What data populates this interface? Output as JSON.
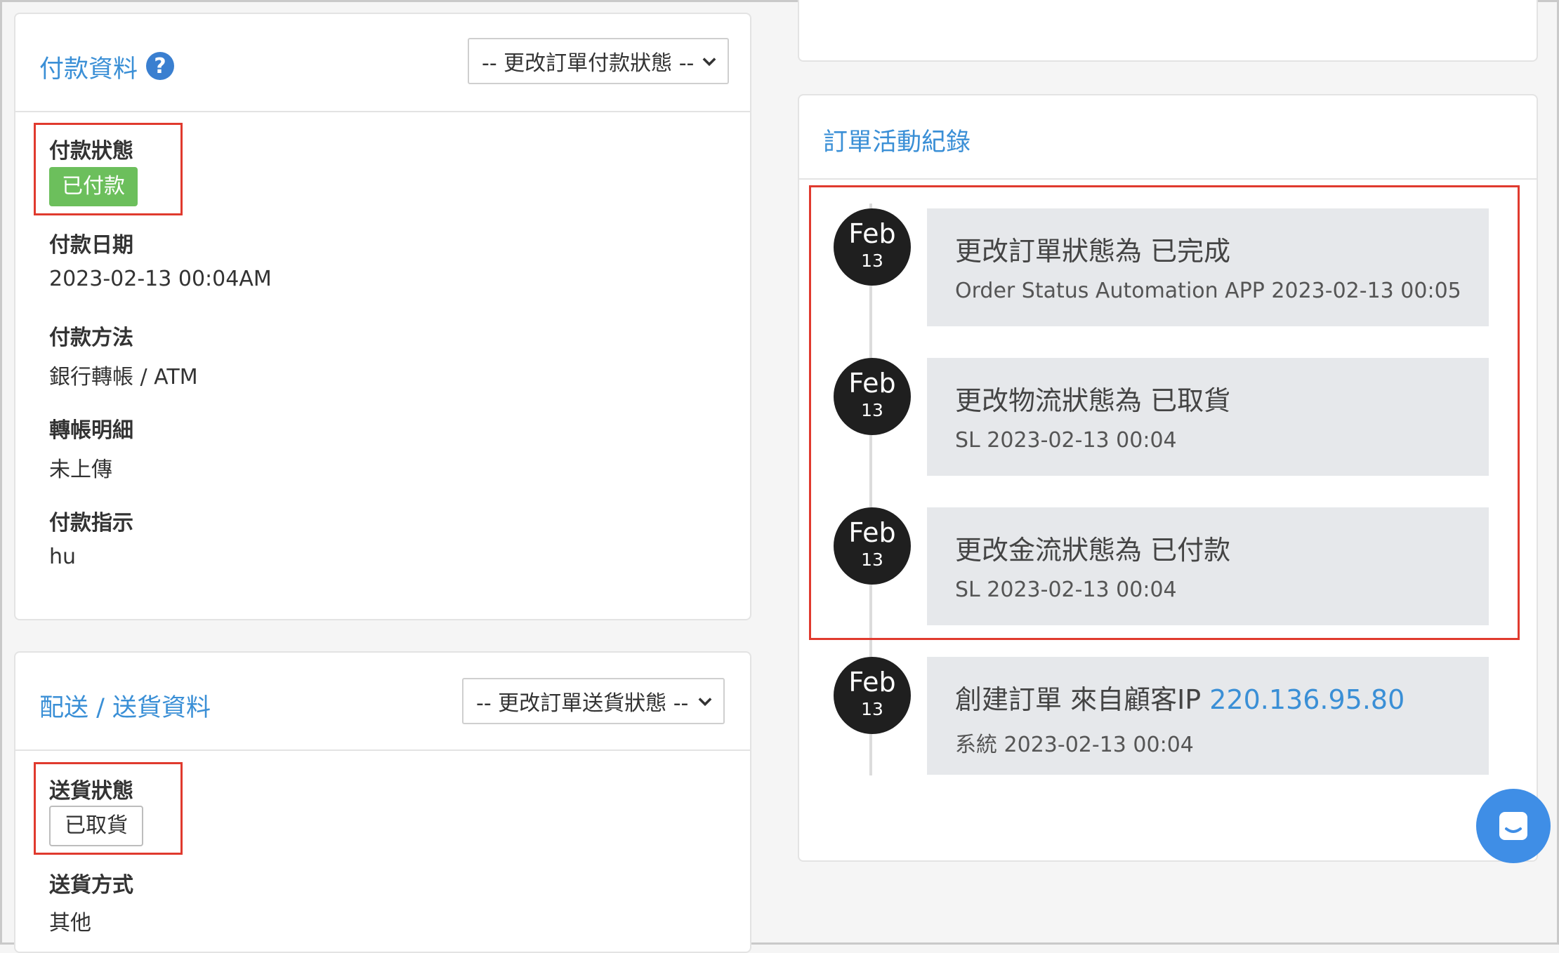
{
  "payment": {
    "title": "付款資料",
    "status_select": "-- 更改訂單付款狀態 --",
    "status_label": "付款狀態",
    "status_value": "已付款",
    "date_label": "付款日期",
    "date_value": "2023-02-13 00:04AM",
    "method_label": "付款方法",
    "method_value": "銀行轉帳 / ATM",
    "transfer_label": "轉帳明細",
    "transfer_value": "未上傳",
    "instruction_label": "付款指示",
    "instruction_value": "hu"
  },
  "delivery": {
    "title": "配送 / 送貨資料",
    "status_select": "-- 更改訂單送貨狀態 --",
    "status_label": "送貨狀態",
    "status_value": "已取貨",
    "method_label": "送貨方式",
    "method_value": "其他"
  },
  "activity": {
    "title": "訂單活動紀錄",
    "entries": [
      {
        "month": "Feb",
        "day": "13",
        "title": "更改訂單狀態為 已完成",
        "meta": "Order Status Automation APP 2023-02-13 00:05"
      },
      {
        "month": "Feb",
        "day": "13",
        "title": "更改物流狀態為 已取貨",
        "meta": "SL 2023-02-13 00:04"
      },
      {
        "month": "Feb",
        "day": "13",
        "title": "更改金流狀態為 已付款",
        "meta": "SL 2023-02-13 00:04"
      },
      {
        "month": "Feb",
        "day": "13",
        "title_prefix": "創建訂單 來自顧客IP ",
        "ip": "220.136.95.80",
        "meta": "系統 2023-02-13 00:04"
      }
    ]
  },
  "icons": {
    "help": "help-icon",
    "select_chevron": "chevron-down-icon",
    "chat": "chat-icon"
  },
  "colors": {
    "accent": "#3a8fd6",
    "paid_badge": "#6cbf5c",
    "highlight": "#e03a2e",
    "chat_button": "#3f8ee6"
  }
}
